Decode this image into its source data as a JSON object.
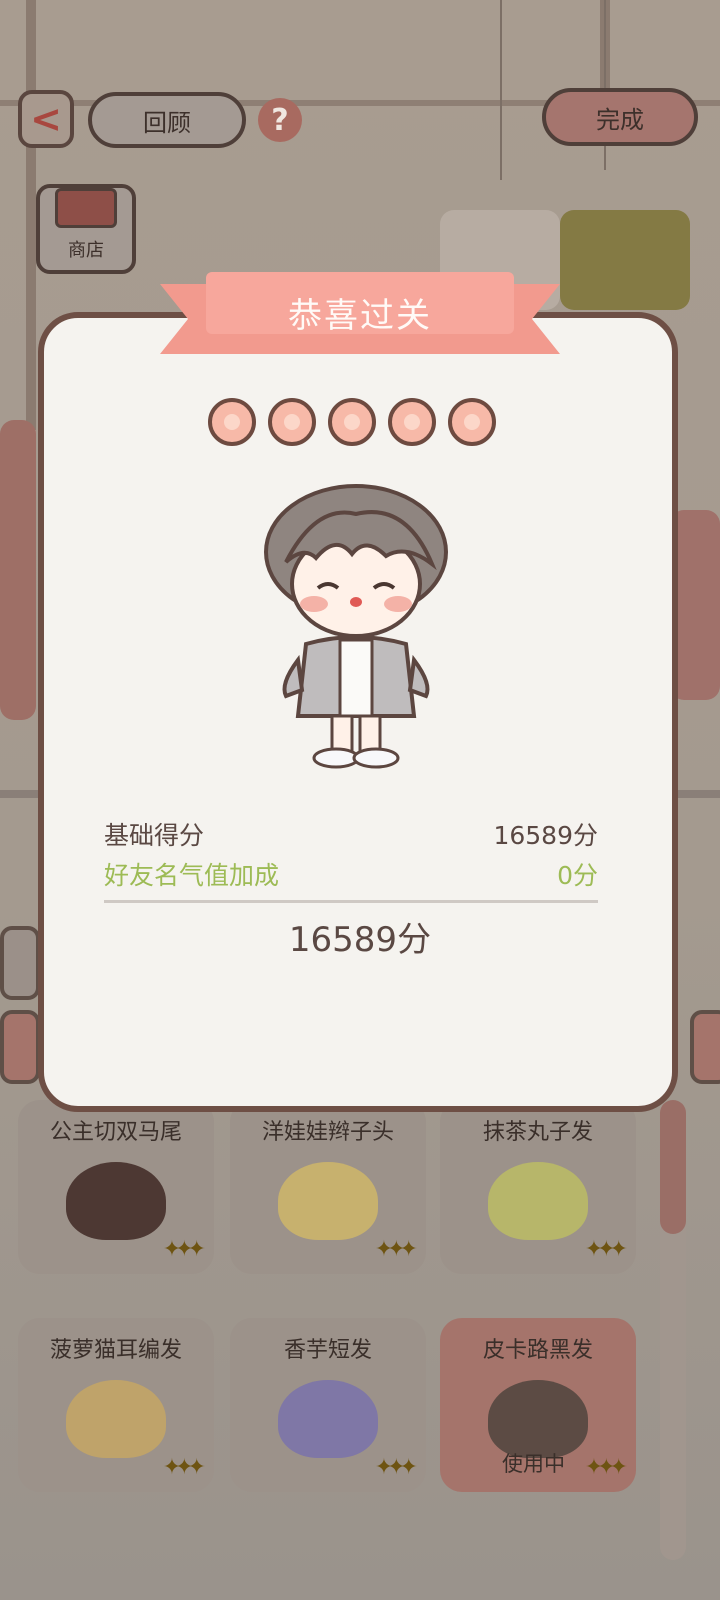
{
  "header": {
    "review_label": "回顾",
    "done_label": "完成",
    "help_glyph": "?",
    "back_glyph": "<",
    "shop_label": "商店"
  },
  "modal": {
    "title": "恭喜过关",
    "stars_count": 5,
    "rows": [
      {
        "label": "基础得分",
        "value": "16589分",
        "color": "#5a4843"
      },
      {
        "label": "好友名气值加成",
        "value": "0分",
        "color": "#9dbb55"
      }
    ],
    "total": "16589分"
  },
  "items": [
    {
      "label": "公主切双马尾",
      "hair_color": "#4d3833",
      "note": ""
    },
    {
      "label": "洋娃娃辫子头",
      "hair_color": "#c7b16e",
      "note": ""
    },
    {
      "label": "抹茶丸子发",
      "hair_color": "#b7b66a",
      "note": ""
    },
    {
      "label": "菠萝猫耳编发",
      "hair_color": "#bfa36a",
      "note": ""
    },
    {
      "label": "香芋短发",
      "hair_color": "#7f77a6",
      "note": ""
    },
    {
      "label": "皮卡路黑发",
      "hair_color": "#5c4b44",
      "note": "使用中"
    }
  ],
  "colors": {
    "accent": "#f29a8e",
    "modal_border": "#6e4f45",
    "bonus_green": "#9dbb55"
  }
}
